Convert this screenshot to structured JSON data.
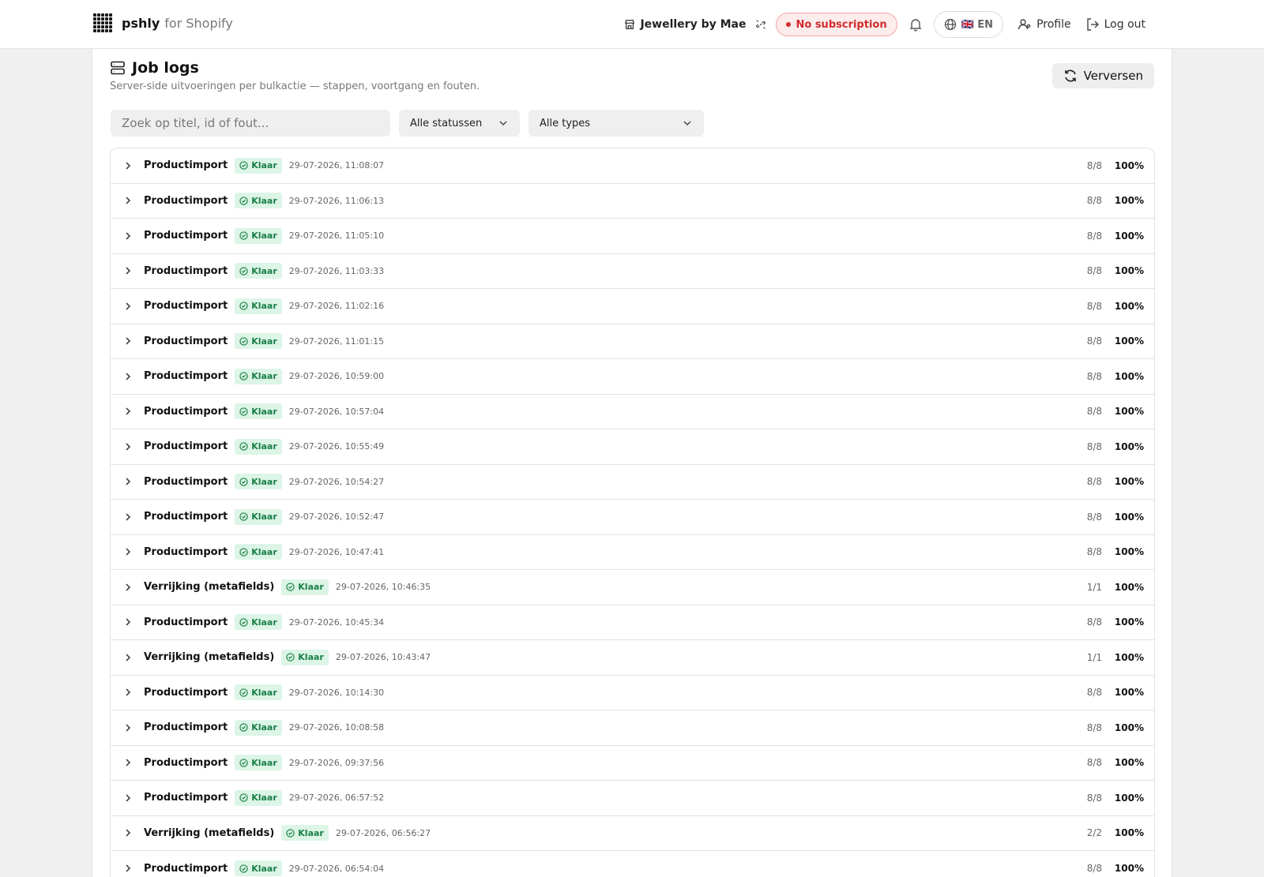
{
  "nav": {
    "brand_name": "pshly",
    "brand_suffix": "for Shopify",
    "store_name": "Jewellery by Mae",
    "subscription": "No subscription",
    "language": "🇬🇧 EN",
    "profile": "Profile",
    "logout": "Log out"
  },
  "page": {
    "title": "Job logs",
    "subtitle": "Server-side uitvoeringen per bulkactie — stappen, voortgang en fouten.",
    "refresh": "Verversen"
  },
  "filters": {
    "search_placeholder": "Zoek op titel, id of fout...",
    "status": "Alle statussen",
    "types": "Alle types"
  },
  "jobs": [
    {
      "title": "Productimport",
      "status": "Klaar",
      "timestamp": "29-07-2026, 11:08:07",
      "count": "8/8",
      "percent": "100%"
    },
    {
      "title": "Productimport",
      "status": "Klaar",
      "timestamp": "29-07-2026, 11:06:13",
      "count": "8/8",
      "percent": "100%"
    },
    {
      "title": "Productimport",
      "status": "Klaar",
      "timestamp": "29-07-2026, 11:05:10",
      "count": "8/8",
      "percent": "100%"
    },
    {
      "title": "Productimport",
      "status": "Klaar",
      "timestamp": "29-07-2026, 11:03:33",
      "count": "8/8",
      "percent": "100%"
    },
    {
      "title": "Productimport",
      "status": "Klaar",
      "timestamp": "29-07-2026, 11:02:16",
      "count": "8/8",
      "percent": "100%"
    },
    {
      "title": "Productimport",
      "status": "Klaar",
      "timestamp": "29-07-2026, 11:01:15",
      "count": "8/8",
      "percent": "100%"
    },
    {
      "title": "Productimport",
      "status": "Klaar",
      "timestamp": "29-07-2026, 10:59:00",
      "count": "8/8",
      "percent": "100%"
    },
    {
      "title": "Productimport",
      "status": "Klaar",
      "timestamp": "29-07-2026, 10:57:04",
      "count": "8/8",
      "percent": "100%"
    },
    {
      "title": "Productimport",
      "status": "Klaar",
      "timestamp": "29-07-2026, 10:55:49",
      "count": "8/8",
      "percent": "100%"
    },
    {
      "title": "Productimport",
      "status": "Klaar",
      "timestamp": "29-07-2026, 10:54:27",
      "count": "8/8",
      "percent": "100%"
    },
    {
      "title": "Productimport",
      "status": "Klaar",
      "timestamp": "29-07-2026, 10:52:47",
      "count": "8/8",
      "percent": "100%"
    },
    {
      "title": "Productimport",
      "status": "Klaar",
      "timestamp": "29-07-2026, 10:47:41",
      "count": "8/8",
      "percent": "100%"
    },
    {
      "title": "Verrijking (metafields)",
      "status": "Klaar",
      "timestamp": "29-07-2026, 10:46:35",
      "count": "1/1",
      "percent": "100%"
    },
    {
      "title": "Productimport",
      "status": "Klaar",
      "timestamp": "29-07-2026, 10:45:34",
      "count": "8/8",
      "percent": "100%"
    },
    {
      "title": "Verrijking (metafields)",
      "status": "Klaar",
      "timestamp": "29-07-2026, 10:43:47",
      "count": "1/1",
      "percent": "100%"
    },
    {
      "title": "Productimport",
      "status": "Klaar",
      "timestamp": "29-07-2026, 10:14:30",
      "count": "8/8",
      "percent": "100%"
    },
    {
      "title": "Productimport",
      "status": "Klaar",
      "timestamp": "29-07-2026, 10:08:58",
      "count": "8/8",
      "percent": "100%"
    },
    {
      "title": "Productimport",
      "status": "Klaar",
      "timestamp": "29-07-2026, 09:37:56",
      "count": "8/8",
      "percent": "100%"
    },
    {
      "title": "Productimport",
      "status": "Klaar",
      "timestamp": "29-07-2026, 06:57:52",
      "count": "8/8",
      "percent": "100%"
    },
    {
      "title": "Verrijking (metafields)",
      "status": "Klaar",
      "timestamp": "29-07-2026, 06:56:27",
      "count": "2/2",
      "percent": "100%"
    },
    {
      "title": "Productimport",
      "status": "Klaar",
      "timestamp": "29-07-2026, 06:54:04",
      "count": "8/8",
      "percent": "100%"
    }
  ],
  "colors": {
    "success_bg": "#dcf5e6",
    "success_text": "#1a7f48",
    "danger": "#d12c2c"
  }
}
